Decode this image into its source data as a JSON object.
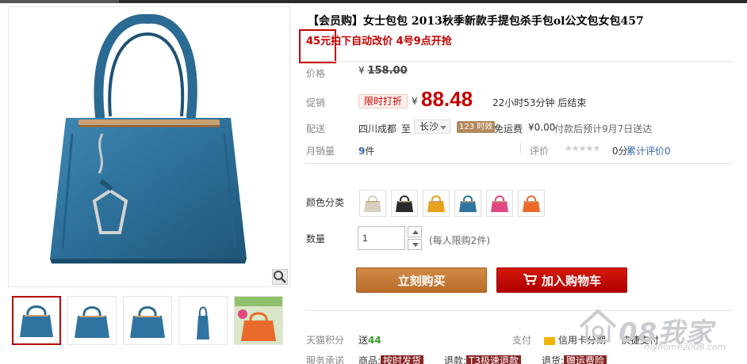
{
  "title": "【会员购】女士包包 2013秋季新款手提包杀手包ol公文包女包457",
  "promo": {
    "price_text": "45元",
    "rest_text": "拍下自动改价 4号9点开抢"
  },
  "price": {
    "label": "价格",
    "currency": "¥",
    "original": "158.00"
  },
  "promotion": {
    "label": "促销",
    "badge": "限时打折",
    "currency": "¥",
    "value": "88.48",
    "countdown": "22小时53分钟 后结束"
  },
  "delivery": {
    "label": "配送",
    "from": "四川成都",
    "to_word": "至",
    "city": "长沙",
    "time_badge": "123 时效",
    "shipping": "免运费",
    "fee": "¥0.00",
    "note": "付款后预计9月7日送达"
  },
  "sales": {
    "label": "月销量",
    "count": "9",
    "unit": "件",
    "rating_label": "评价",
    "stars": "★★★★★",
    "score": "0分",
    "review_link": "累计评价0"
  },
  "colors": {
    "label": "颜色分类",
    "options": [
      {
        "name": "beige",
        "color": "#d9cfbf"
      },
      {
        "name": "black",
        "color": "#2a2a2a"
      },
      {
        "name": "yellow",
        "color": "#e8a21e"
      },
      {
        "name": "blue",
        "color": "#2f74a0"
      },
      {
        "name": "pink",
        "color": "#e0487f"
      },
      {
        "name": "orange",
        "color": "#ea6a2c"
      }
    ]
  },
  "quantity": {
    "label": "数量",
    "value": "1",
    "limit": "(每人限购2件)"
  },
  "buttons": {
    "buy_now": "立刻购买",
    "add_cart": "加入购物车"
  },
  "points": {
    "label": "天猫积分",
    "prefix": "送",
    "value": "44",
    "pay_label": "支付",
    "pay_method": "信用卡分期",
    "quick_pay": "快捷支付"
  },
  "service": {
    "label": "服务承诺",
    "items": [
      {
        "prefix": "商品:",
        "tag": "按时发货"
      },
      {
        "prefix": "退款:",
        "tag": "T3极速退款"
      },
      {
        "prefix": "退货:",
        "tag": "赠运费险"
      }
    ]
  },
  "watermark": {
    "text": "08我家",
    "url": "myhome2008.com"
  },
  "accent_colors": {
    "price_red": "#c40000",
    "buy_button": "#c07a35",
    "cart_button": "#c00a00",
    "product_blue": "#2f74a0"
  }
}
